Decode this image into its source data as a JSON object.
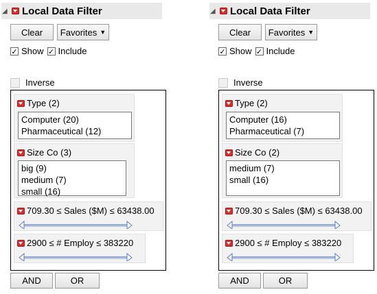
{
  "panels": [
    {
      "title": "Local Data Filter",
      "clear_label": "Clear",
      "favorites_label": "Favorites",
      "show_label": "Show",
      "include_label": "Include",
      "inverse_label": "Inverse",
      "type_header": "Type (2)",
      "type_items": [
        "Computer (20)",
        "Pharmaceutical (12)"
      ],
      "size_header": "Size Co (3)",
      "size_items": [
        "big (9)",
        "medium (7)",
        "small (16)"
      ],
      "sales_label": "709.30 ≤ Sales ($M) ≤ 63438.00",
      "employ_label": "2900 ≤ # Employ ≤ 383220",
      "and_label": "AND",
      "or_label": "OR"
    },
    {
      "title": "Local Data Filter",
      "clear_label": "Clear",
      "favorites_label": "Favorites",
      "show_label": "Show",
      "include_label": "Include",
      "inverse_label": "Inverse",
      "type_header": "Type (2)",
      "type_items": [
        "Computer (16)",
        "Pharmaceutical (7)"
      ],
      "size_header": "Size Co (2)",
      "size_items": [
        "medium (7)",
        "small (16)"
      ],
      "sales_label": "709.30 ≤ Sales ($M) ≤ 63438.00",
      "employ_label": "2900 ≤ # Employ ≤ 383220",
      "and_label": "AND",
      "or_label": "OR"
    }
  ],
  "icons": {
    "collapse": "collapse-triangle-icon",
    "menu": "red-menu-icon",
    "check": "checkmark-icon",
    "slider": "range-slider-arrows-icon"
  },
  "colors": {
    "menu_red": "#d62e2e",
    "slider_blue": "#5b7fc2"
  }
}
